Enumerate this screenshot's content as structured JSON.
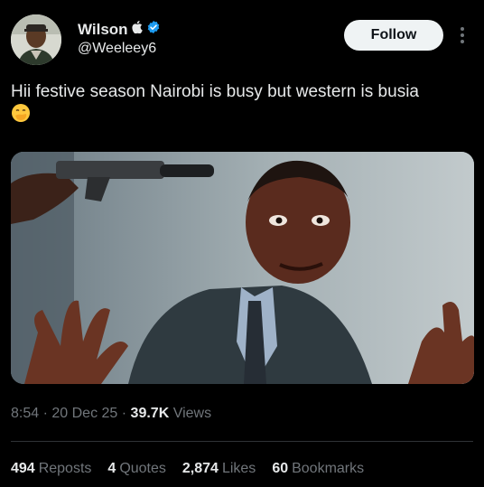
{
  "author": {
    "name": "Wilson",
    "handle": "@Weeleey6"
  },
  "follow_button": {
    "label": "Follow"
  },
  "tweet": {
    "text": "Hii festive season Nairobi is busy but western is busia",
    "emoji": "🤭"
  },
  "meta": {
    "time": "8:54",
    "date": "20 Dec 25",
    "views": "39.7K",
    "views_label": "Views",
    "separator": "·"
  },
  "stats": {
    "reposts": {
      "count": "494",
      "label": "Reposts"
    },
    "quotes": {
      "count": "4",
      "label": "Quotes"
    },
    "likes": {
      "count": "2,874",
      "label": "Likes"
    },
    "bookmarks": {
      "count": "60",
      "label": "Bookmarks"
    }
  },
  "colors": {
    "background": "#000000",
    "text": "#e7e9ea",
    "muted": "#71767b",
    "verified": "#1d9bf0",
    "follow_bg": "#eff3f4"
  },
  "icons": {
    "verified": "verified-badge-icon",
    "apple": "apple-icon",
    "more": "more-options-icon"
  }
}
